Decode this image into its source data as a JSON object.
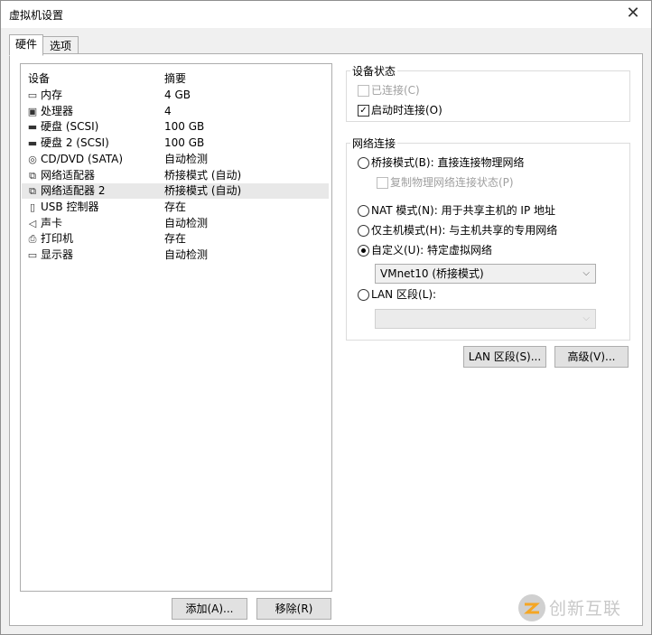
{
  "window": {
    "title": "虚拟机设置",
    "close_glyph": "✕"
  },
  "tabs": [
    {
      "label": "硬件",
      "active": true
    },
    {
      "label": "选项",
      "active": false
    }
  ],
  "device_list": {
    "headers": {
      "device": "设备",
      "summary": "摘要"
    },
    "rows": [
      {
        "icon": "memory-icon",
        "glyph": "▭",
        "name": "内存",
        "summary": "4 GB"
      },
      {
        "icon": "processor-icon",
        "glyph": "▣",
        "name": "处理器",
        "summary": "4"
      },
      {
        "icon": "hard-disk-icon",
        "glyph": "▬",
        "name": "硬盘 (SCSI)",
        "summary": "100 GB"
      },
      {
        "icon": "hard-disk-icon",
        "glyph": "▬",
        "name": "硬盘 2 (SCSI)",
        "summary": "100 GB"
      },
      {
        "icon": "cd-dvd-icon",
        "glyph": "◎",
        "name": "CD/DVD (SATA)",
        "summary": "自动检测"
      },
      {
        "icon": "network-adapter-icon",
        "glyph": "⧉",
        "name": "网络适配器",
        "summary": "桥接模式 (自动)"
      },
      {
        "icon": "network-adapter-icon",
        "glyph": "⧉",
        "name": "网络适配器 2",
        "summary": "桥接模式 (自动)",
        "selected": true
      },
      {
        "icon": "usb-icon",
        "glyph": "▯",
        "name": "USB 控制器",
        "summary": "存在"
      },
      {
        "icon": "sound-card-icon",
        "glyph": "◁",
        "name": "声卡",
        "summary": "自动检测"
      },
      {
        "icon": "printer-icon",
        "glyph": "⎙",
        "name": "打印机",
        "summary": "存在"
      },
      {
        "icon": "display-icon",
        "glyph": "▭",
        "name": "显示器",
        "summary": "自动检测"
      }
    ],
    "add_button": "添加(A)...",
    "remove_button": "移除(R)"
  },
  "device_status": {
    "title": "设备状态",
    "connected": {
      "label": "已连接(C)",
      "checked": false,
      "disabled": true
    },
    "connect_at_power_on": {
      "label": "启动时连接(O)",
      "checked": true,
      "disabled": false
    }
  },
  "network_connection": {
    "title": "网络连接",
    "bridged": {
      "label": "桥接模式(B): 直接连接物理网络",
      "checked": false
    },
    "replicate_state": {
      "label": "复制物理网络连接状态(P)",
      "checked": false,
      "disabled": true
    },
    "nat": {
      "label": "NAT 模式(N): 用于共享主机的 IP 地址",
      "checked": false
    },
    "host_only": {
      "label": "仅主机模式(H): 与主机共享的专用网络",
      "checked": false
    },
    "custom": {
      "label": "自定义(U): 特定虚拟网络",
      "checked": true
    },
    "custom_select": {
      "value": "VMnet10 (桥接模式)"
    },
    "lan_segment": {
      "label": "LAN 区段(L):",
      "checked": false
    },
    "lan_select": {
      "value": ""
    }
  },
  "buttons": {
    "lan_segments": "LAN 区段(S)...",
    "advanced": "高级(V)..."
  },
  "watermark": {
    "text": "创新互联"
  },
  "colors": {
    "check_mark": "✓",
    "dropdown_arrow": "⌵"
  }
}
